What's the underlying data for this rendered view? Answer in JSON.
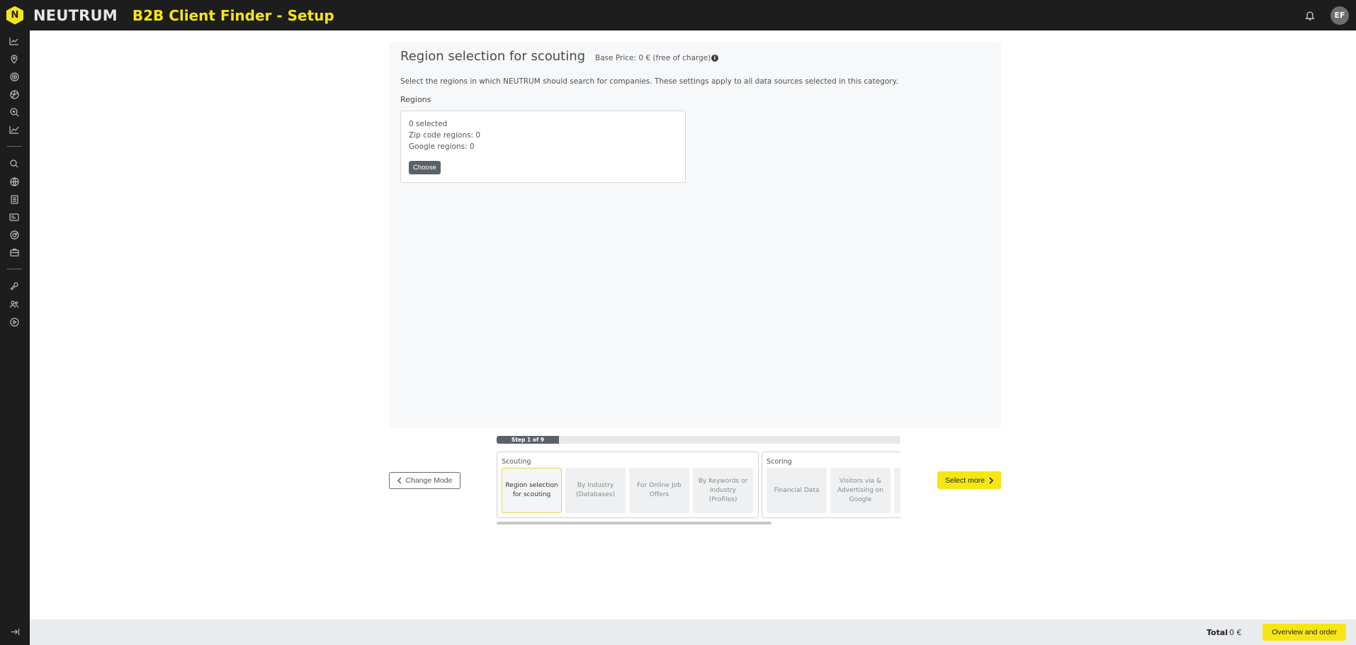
{
  "header": {
    "logo_letter": "N",
    "brand": "NEUTRUM",
    "title": "B2B Client Finder - Setup",
    "avatar_initials": "EF"
  },
  "sidebar": {
    "icons": [
      "chart-line-icon",
      "map-pin-icon",
      "target-icon",
      "aperture-icon",
      "search-zoom-icon",
      "trend-icon",
      "search-icon",
      "globe-icon",
      "document-icon",
      "id-card-icon",
      "radar-icon",
      "briefcase-icon",
      "wrench-icon",
      "users-icon",
      "play-icon"
    ],
    "logout_icon": "logout-icon"
  },
  "panel": {
    "title": "Region selection for scouting",
    "base_price": "Base Price: 0 € (free of charge)",
    "description": "Select the regions in which NEUTRUM should search for companies. These settings apply to all data sources selected in this category.",
    "regions_label": "Regions",
    "regions_box": {
      "selected": "0 selected",
      "zip_code_regions": "Zip code regions: 0",
      "google_regions": "Google regions: 0",
      "choose_label": "Choose"
    }
  },
  "stepper": {
    "change_mode_label": "Change Mode",
    "progress_label": "Step 1 of 9",
    "progress_fraction": 0.111,
    "groups": [
      {
        "title": "Scouting",
        "steps": [
          "Region selection for scouting",
          "By Industry (Databases)",
          "For Online Job Offers",
          "By Keywords or Industry (Profiles)"
        ]
      },
      {
        "title": "Scoring",
        "steps": [
          "Financial Data",
          "Visitors via & Advertising on Google"
        ]
      }
    ],
    "select_more_label": "Select more"
  },
  "footer": {
    "total_label": "Total",
    "total_value": "0 €",
    "order_label": "Overview and order"
  },
  "colors": {
    "accent_yellow": "#f5e614",
    "dark": "#1d1d1d",
    "button_gray": "#5b6168"
  }
}
